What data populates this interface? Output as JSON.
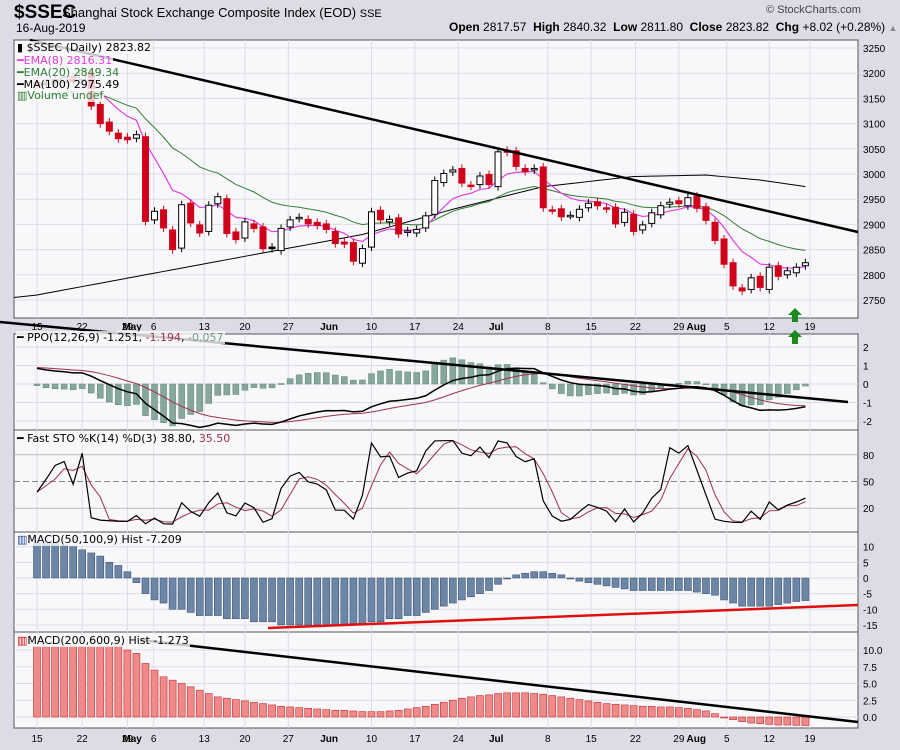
{
  "header": {
    "symbol": "$SSEC",
    "name": "Shanghai Stock Exchange Composite Index (EOD)",
    "exchange": "SSE",
    "date": "16-Aug-2019",
    "copyright": "© StockCharts.com",
    "open_label": "Open",
    "open": "2817.57",
    "high_label": "High",
    "high": "2840.32",
    "low_label": "Low",
    "low": "2811.80",
    "close_label": "Close",
    "close": "2823.82",
    "chg_label": "Chg",
    "chg": "+8.02 (+0.28%)"
  },
  "legends": {
    "price": "$SSEC (Daily) 2823.82",
    "ema8": "EMA(8) 2816.31",
    "ema20": "EMA(20) 2849.34",
    "ma100": "MA(100) 2975.49",
    "volume": "Volume undef",
    "ppo": "PPO(12,26,9) -1.251,",
    "ppo_signal": "-1.194",
    "ppo_hist": "-0.057",
    "sto": "Fast STO %K(14) %D(3) 38.80,",
    "sto_d": "35.50",
    "macd1": "MACD(50,100,9) Hist -7.209",
    "macd2": "MACD(200,600,9) Hist -1.273"
  },
  "colors": {
    "up": "#000000",
    "down": "#d0021b",
    "ema8": "#e040e0",
    "ema20": "#2e7d32",
    "ma100": "#000000",
    "ppo_hist": "#86a89c",
    "macd1_hist": "#6e86a6",
    "macd2_hist": "#f08a8a",
    "sto_d": "#a0304a",
    "arrow": "#1a8a1a"
  },
  "chart_data": {
    "type": "candlestick",
    "title": "$SSEC Shanghai Stock Exchange Composite Index (EOD)",
    "price": {
      "closes": [
        3177,
        3180,
        3186,
        3190,
        3184,
        3205,
        3135,
        3100,
        3085,
        3070,
        3068,
        3078,
        2906,
        2926,
        2893,
        2850,
        2939,
        2903,
        2883,
        2938,
        2955,
        2882,
        2870,
        2905,
        2892,
        2852,
        2852,
        2892,
        2909,
        2914,
        2901,
        2898,
        2890,
        2862,
        2861,
        2827,
        2852,
        2925,
        2909,
        2910,
        2881,
        2887,
        2890,
        2917,
        2987,
        3001,
        3008,
        2982,
        2976,
        2996,
        2979,
        3044,
        3043,
        3015,
        3005,
        3011,
        2933,
        2928,
        2915,
        2918,
        2930,
        2942,
        2937,
        2931,
        2901,
        2924,
        2886,
        2899,
        2923,
        2937,
        2944,
        2941,
        2953,
        2932,
        2908,
        2868,
        2821,
        2778,
        2768,
        2794,
        2775,
        2815,
        2797,
        2808,
        2815,
        2824
      ],
      "ma100": [
        [
          0,
          2760
        ],
        [
          12,
          2800
        ],
        [
          24,
          2840
        ],
        [
          36,
          2880
        ],
        [
          46,
          2930
        ],
        [
          56,
          2975
        ],
        [
          66,
          2995
        ],
        [
          74,
          2998
        ],
        [
          80,
          2988
        ],
        [
          85,
          2975
        ]
      ],
      "yticks": [
        3250,
        3200,
        3150,
        3100,
        3050,
        3000,
        2950,
        2900,
        2850,
        2800,
        2750
      ]
    },
    "x_ticks": [
      {
        "label": "15",
        "idx": 0
      },
      {
        "label": "22",
        "idx": 5
      },
      {
        "label": "29",
        "idx": 10
      },
      {
        "label": "May",
        "idx": 11.6,
        "month": true
      },
      {
        "label": "6",
        "idx": 12.9
      },
      {
        "label": "13",
        "idx": 18.5
      },
      {
        "label": "20",
        "idx": 23
      },
      {
        "label": "27",
        "idx": 27.8
      },
      {
        "label": "Jun",
        "idx": 33.3,
        "month": true
      },
      {
        "label": "10",
        "idx": 37
      },
      {
        "label": "17",
        "idx": 41.8
      },
      {
        "label": "24",
        "idx": 46.6
      },
      {
        "label": "Jul",
        "idx": 51.6,
        "month": true
      },
      {
        "label": "8",
        "idx": 56.5
      },
      {
        "label": "15",
        "idx": 61.3
      },
      {
        "label": "22",
        "idx": 66.2
      },
      {
        "label": "29",
        "idx": 71
      },
      {
        "label": "Aug",
        "idx": 74,
        "month": true
      },
      {
        "label": "5",
        "idx": 76.3
      },
      {
        "label": "12",
        "idx": 81
      },
      {
        "label": "19",
        "idx": 85.5
      }
    ],
    "ppo": {
      "yticks": [
        2,
        1,
        0,
        -1,
        -2
      ]
    },
    "sto": {
      "yticks": [
        80,
        50,
        20
      ]
    },
    "macd1": {
      "yticks": [
        10,
        5,
        0,
        -5,
        -10,
        -15
      ],
      "hist": [
        11,
        11,
        11,
        10.5,
        10,
        9,
        8,
        7,
        5,
        4,
        2,
        -1.5,
        -5,
        -7,
        -8,
        -10,
        -10,
        -11,
        -12,
        -12,
        -12,
        -13,
        -13,
        -13,
        -14,
        -14,
        -14,
        -15,
        -15,
        -15,
        -15,
        -15,
        -15,
        -15,
        -15,
        -15,
        -15,
        -14,
        -14,
        -13,
        -13,
        -12,
        -12,
        -11,
        -10,
        -9,
        -8,
        -7,
        -6,
        -5,
        -4,
        -2,
        0,
        1,
        1.5,
        2,
        2,
        1.5,
        1,
        0,
        -1,
        -1.5,
        -2,
        -2.5,
        -3,
        -3.5,
        -4,
        -4,
        -4,
        -4,
        -4,
        -4,
        -4,
        -4.5,
        -5,
        -5.5,
        -7,
        -8,
        -9,
        -9,
        -9,
        -9,
        -8.5,
        -8,
        -7.5,
        -7.209
      ]
    },
    "macd2": {
      "yticks": [
        "10.0",
        "7.5",
        "5.0",
        "2.5",
        "0.0"
      ],
      "hist": [
        10.5,
        10.5,
        10.5,
        10.5,
        10.5,
        10.5,
        10.5,
        10.5,
        10.5,
        10.5,
        10,
        9.5,
        8,
        7,
        6,
        5.5,
        5,
        4.5,
        4,
        3.5,
        3,
        2.8,
        2.6,
        2.4,
        2.2,
        2,
        1.8,
        1.6,
        1.5,
        1.4,
        1.3,
        1.2,
        1.1,
        1,
        1,
        0.9,
        0.8,
        0.8,
        0.8,
        0.9,
        1,
        1.2,
        1.4,
        1.6,
        1.9,
        2.2,
        2.5,
        2.8,
        3,
        3.2,
        3.3,
        3.5,
        3.6,
        3.6,
        3.6,
        3.5,
        3.4,
        3.2,
        3,
        2.8,
        2.6,
        2.4,
        2.2,
        2,
        1.9,
        1.8,
        1.7,
        1.6,
        1.6,
        1.5,
        1.5,
        1.4,
        1.3,
        1.1,
        0.9,
        0.5,
        0,
        -0.4,
        -0.7,
        -0.9,
        -1,
        -1.1,
        -1.2,
        -1.2,
        -1.25,
        -1.273
      ]
    }
  }
}
